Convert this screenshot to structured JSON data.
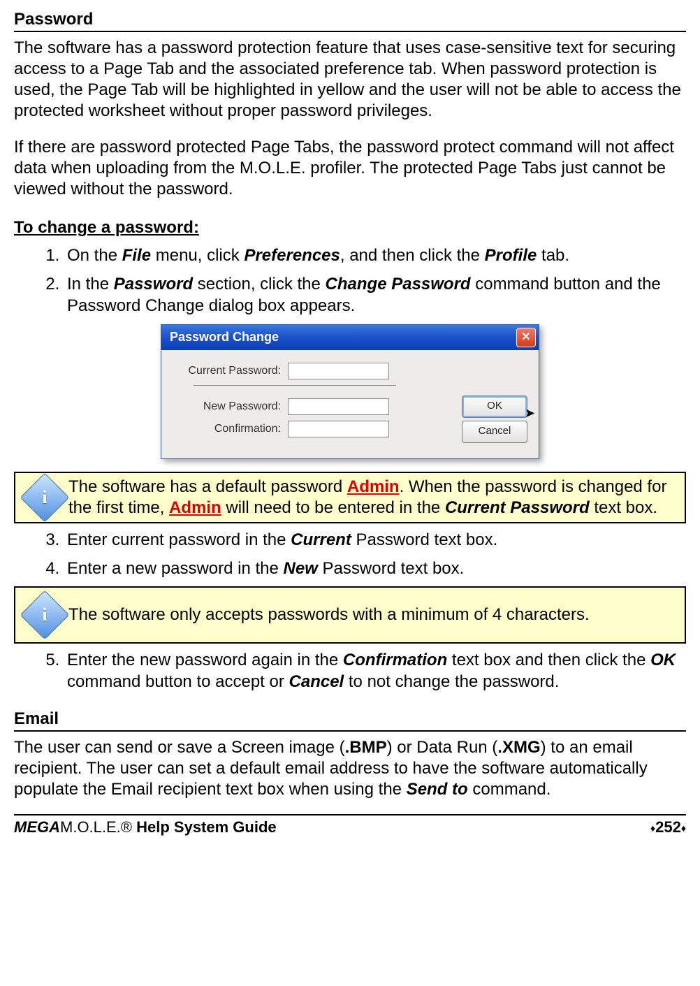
{
  "password_section": {
    "heading": "Password",
    "para1": "The software has a password protection feature that uses case-sensitive text for securing access to a Page Tab and the associated preference tab. When password protection is used, the Page Tab will be highlighted in yellow and the user will not be able to access the protected worksheet without proper password privileges.",
    "para2": "If there are password protected Page Tabs, the password protect command will not affect data when uploading from the M.O.L.E. profiler. The protected Page Tabs just cannot be viewed without the password.",
    "change_heading": "To change a password:",
    "step1_a": "On the ",
    "step1_file": "File",
    "step1_b": " menu, click ",
    "step1_prefs": "Preferences",
    "step1_c": ", and then click the ",
    "step1_profile": "Profile",
    "step1_d": " tab.",
    "step2_a": "In the ",
    "step2_pw": "Password",
    "step2_b": " section, click the ",
    "step2_chg": "Change Password",
    "step2_c": " command button and the Password Change dialog box appears.",
    "step3_a": "Enter current password in the ",
    "step3_current": "Current",
    "step3_b": " Password text box.",
    "step4_a": "Enter a new password in the ",
    "step4_new": "New",
    "step4_b": " Password text box.",
    "step5_a": "Enter the new password again in the ",
    "step5_conf": "Confirmation",
    "step5_b": " text box and then click the ",
    "step5_ok": "OK",
    "step5_c": " command button to accept or ",
    "step5_cancel": "Cancel",
    "step5_d": " to not change the password."
  },
  "dialog": {
    "title": "Password Change",
    "close_glyph": "✕",
    "label_current": "Current Password:",
    "label_new": "New Password:",
    "label_confirm": "Confirmation:",
    "ok": "OK",
    "cancel": "Cancel"
  },
  "note1": {
    "t1": "The software has a default password ",
    "admin1": "Admin",
    "t2": ". When the password is changed for the first time, ",
    "admin2": "Admin",
    "t3": " will need to be entered in the ",
    "curpw": "Current Password",
    "t4": " text box."
  },
  "note2": {
    "text": "The software only accepts passwords with a minimum of 4 characters."
  },
  "email_section": {
    "heading": "Email",
    "para_a": "The user can send or save a Screen image (",
    "bmp": ".BMP",
    "para_b": ") or Data Run (",
    "xmg": ".XMG",
    "para_c": ") to an email recipient. The user can set a default email address to have the software automatically populate the Email recipient text box when using the ",
    "sendto": "Send to",
    "para_d": " command."
  },
  "footer": {
    "mega": "MEGA",
    "mole": "M.O.L.E.® ",
    "guide": "Help System Guide",
    "pagenum": "252"
  }
}
